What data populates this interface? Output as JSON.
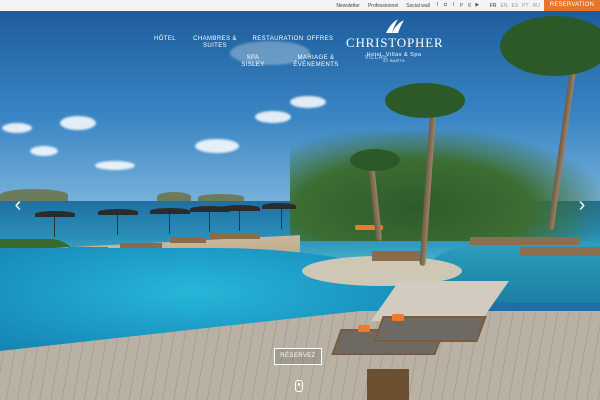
{
  "topbar": {
    "links": [
      "Newsletter",
      "Professionnel",
      "Social wall"
    ],
    "social_icons": [
      "facebook-icon",
      "instagram-icon",
      "twitter-icon",
      "pinterest-icon",
      "google-plus-icon",
      "youtube-icon"
    ],
    "languages": [
      "FR",
      "EN",
      "ES",
      "PT",
      "RU"
    ],
    "active_language": "FR",
    "reserve_label": "RESERVATION",
    "reserve_color": "#e8732a"
  },
  "nav": {
    "hotel": "HÔTEL",
    "rooms_line1": "CHAMBRES &",
    "rooms_line2": "SUITES",
    "restaurant": "RESTAURATION",
    "offers": "OFFRES",
    "spa_line1": "SPA",
    "spa_line2": "SISLEY",
    "wedding_line1": "MARIAGE &",
    "wedding_line2": "ÉVÉNEMENTS",
    "villas": "VILLAS"
  },
  "logo": {
    "name": "CHRISTOPHER",
    "subtitle": "Hotel, Villas & Spa",
    "place": "ST BARTH"
  },
  "hero": {
    "reserve_button": "RÉSERVEZ",
    "prev_arrow": "‹",
    "next_arrow": "›"
  }
}
